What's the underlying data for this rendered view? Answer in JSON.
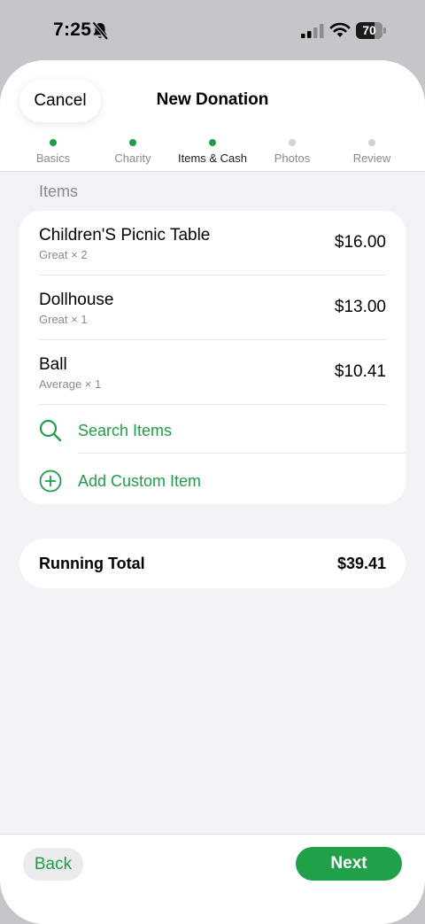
{
  "status_bar": {
    "time": "7:25",
    "battery_level": "70",
    "battery_fraction": 0.7,
    "icons": [
      "bell-slash-icon",
      "signal-icon",
      "wifi-icon",
      "battery-icon"
    ]
  },
  "header": {
    "cancel_label": "Cancel",
    "title": "New Donation"
  },
  "steps": [
    {
      "label": "Basics",
      "state": "done"
    },
    {
      "label": "Charity",
      "state": "done"
    },
    {
      "label": "Items & Cash",
      "state": "current"
    },
    {
      "label": "Photos",
      "state": "pending"
    },
    {
      "label": "Review",
      "state": "pending"
    }
  ],
  "colors": {
    "accent": "#21a04a",
    "step_active": "#1f9d48",
    "step_inactive": "#d1d1d6",
    "background": "#f2f2f7"
  },
  "items_section": {
    "label": "Items",
    "items": [
      {
        "name": "Children'S Picnic Table",
        "detail": "Great × 2",
        "price": "$16.00"
      },
      {
        "name": "Dollhouse",
        "detail": "Great × 1",
        "price": "$13.00"
      },
      {
        "name": "Ball",
        "detail": "Average × 1",
        "price": "$10.41"
      }
    ],
    "search_label": "Search Items",
    "search_icon": "magnifier-icon",
    "add_label": "Add Custom Item",
    "add_icon": "plus-circle-icon"
  },
  "total": {
    "label": "Running Total",
    "value": "$39.41"
  },
  "footer": {
    "back_label": "Back",
    "next_label": "Next"
  }
}
